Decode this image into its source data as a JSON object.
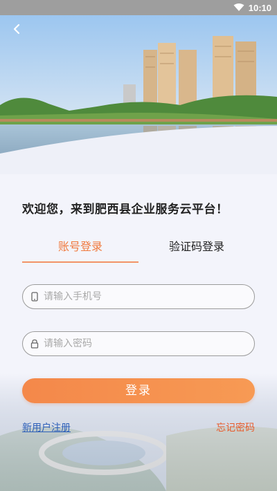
{
  "status_bar": {
    "time": "10:10"
  },
  "header": {
    "back_icon": "chevron-left-icon"
  },
  "welcome": {
    "text": "欢迎您，来到肥西县企业服务云平台！"
  },
  "tabs": [
    {
      "label": "账号登录",
      "active": true
    },
    {
      "label": "验证码登录",
      "active": false
    }
  ],
  "form": {
    "phone": {
      "value": "",
      "placeholder": "请输入手机号",
      "icon": "phone-icon"
    },
    "password": {
      "value": "",
      "placeholder": "请输入密码",
      "icon": "lock-icon"
    },
    "login_label": "登录"
  },
  "links": {
    "register": "新用户注册",
    "forgot": "忘记密码"
  },
  "colors": {
    "accent": "#f07a3e",
    "link_blue": "#2d5fb8",
    "link_orange": "#e85a2a"
  }
}
